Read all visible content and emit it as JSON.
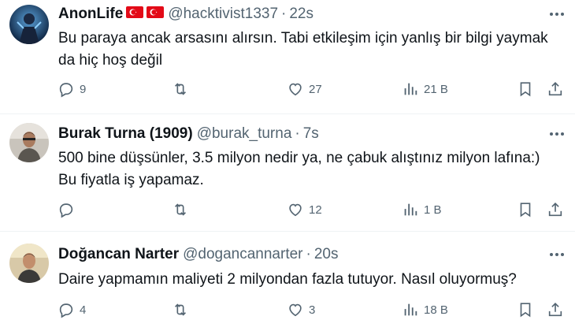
{
  "tweets": [
    {
      "name": "AnonLife",
      "flags": [
        "turkey-flag-icon",
        "turkey-flag-icon"
      ],
      "handle": "@hacktivist1337",
      "dot": "·",
      "time": "22s",
      "text": "Bu paraya ancak arsasını alırsın. Tabi etkileşim için yanlış bir bilgi yaymak da hiç hoş değil",
      "replies": "9",
      "retweets": "",
      "likes": "27",
      "views": "21 B"
    },
    {
      "name": "Burak Turna (1909)",
      "handle": "@burak_turna",
      "dot": "·",
      "time": "7s",
      "text": "500 bine düşsünler, 3.5 milyon nedir ya, ne çabuk alıştınız milyon lafına:) Bu fiyatla iş yapamaz.",
      "replies": "",
      "retweets": "",
      "likes": "12",
      "views": "1 B"
    },
    {
      "name": "Doğancan Narter",
      "handle": "@dogancannarter",
      "dot": "·",
      "time": "20s",
      "text": "Daire yapmamın maliyeti 2 milyondan fazla tutuyor. Nasıl oluyormuş?",
      "replies": "4",
      "retweets": "",
      "likes": "3",
      "views": "18 B"
    }
  ],
  "colors": {
    "text_primary": "#0f1419",
    "text_secondary": "#536471",
    "divider": "#eff3f4",
    "flag_red": "#e30a17"
  },
  "icons": [
    "reply-icon",
    "retweet-icon",
    "like-icon",
    "views-icon",
    "bookmark-icon",
    "share-icon",
    "more-icon"
  ]
}
